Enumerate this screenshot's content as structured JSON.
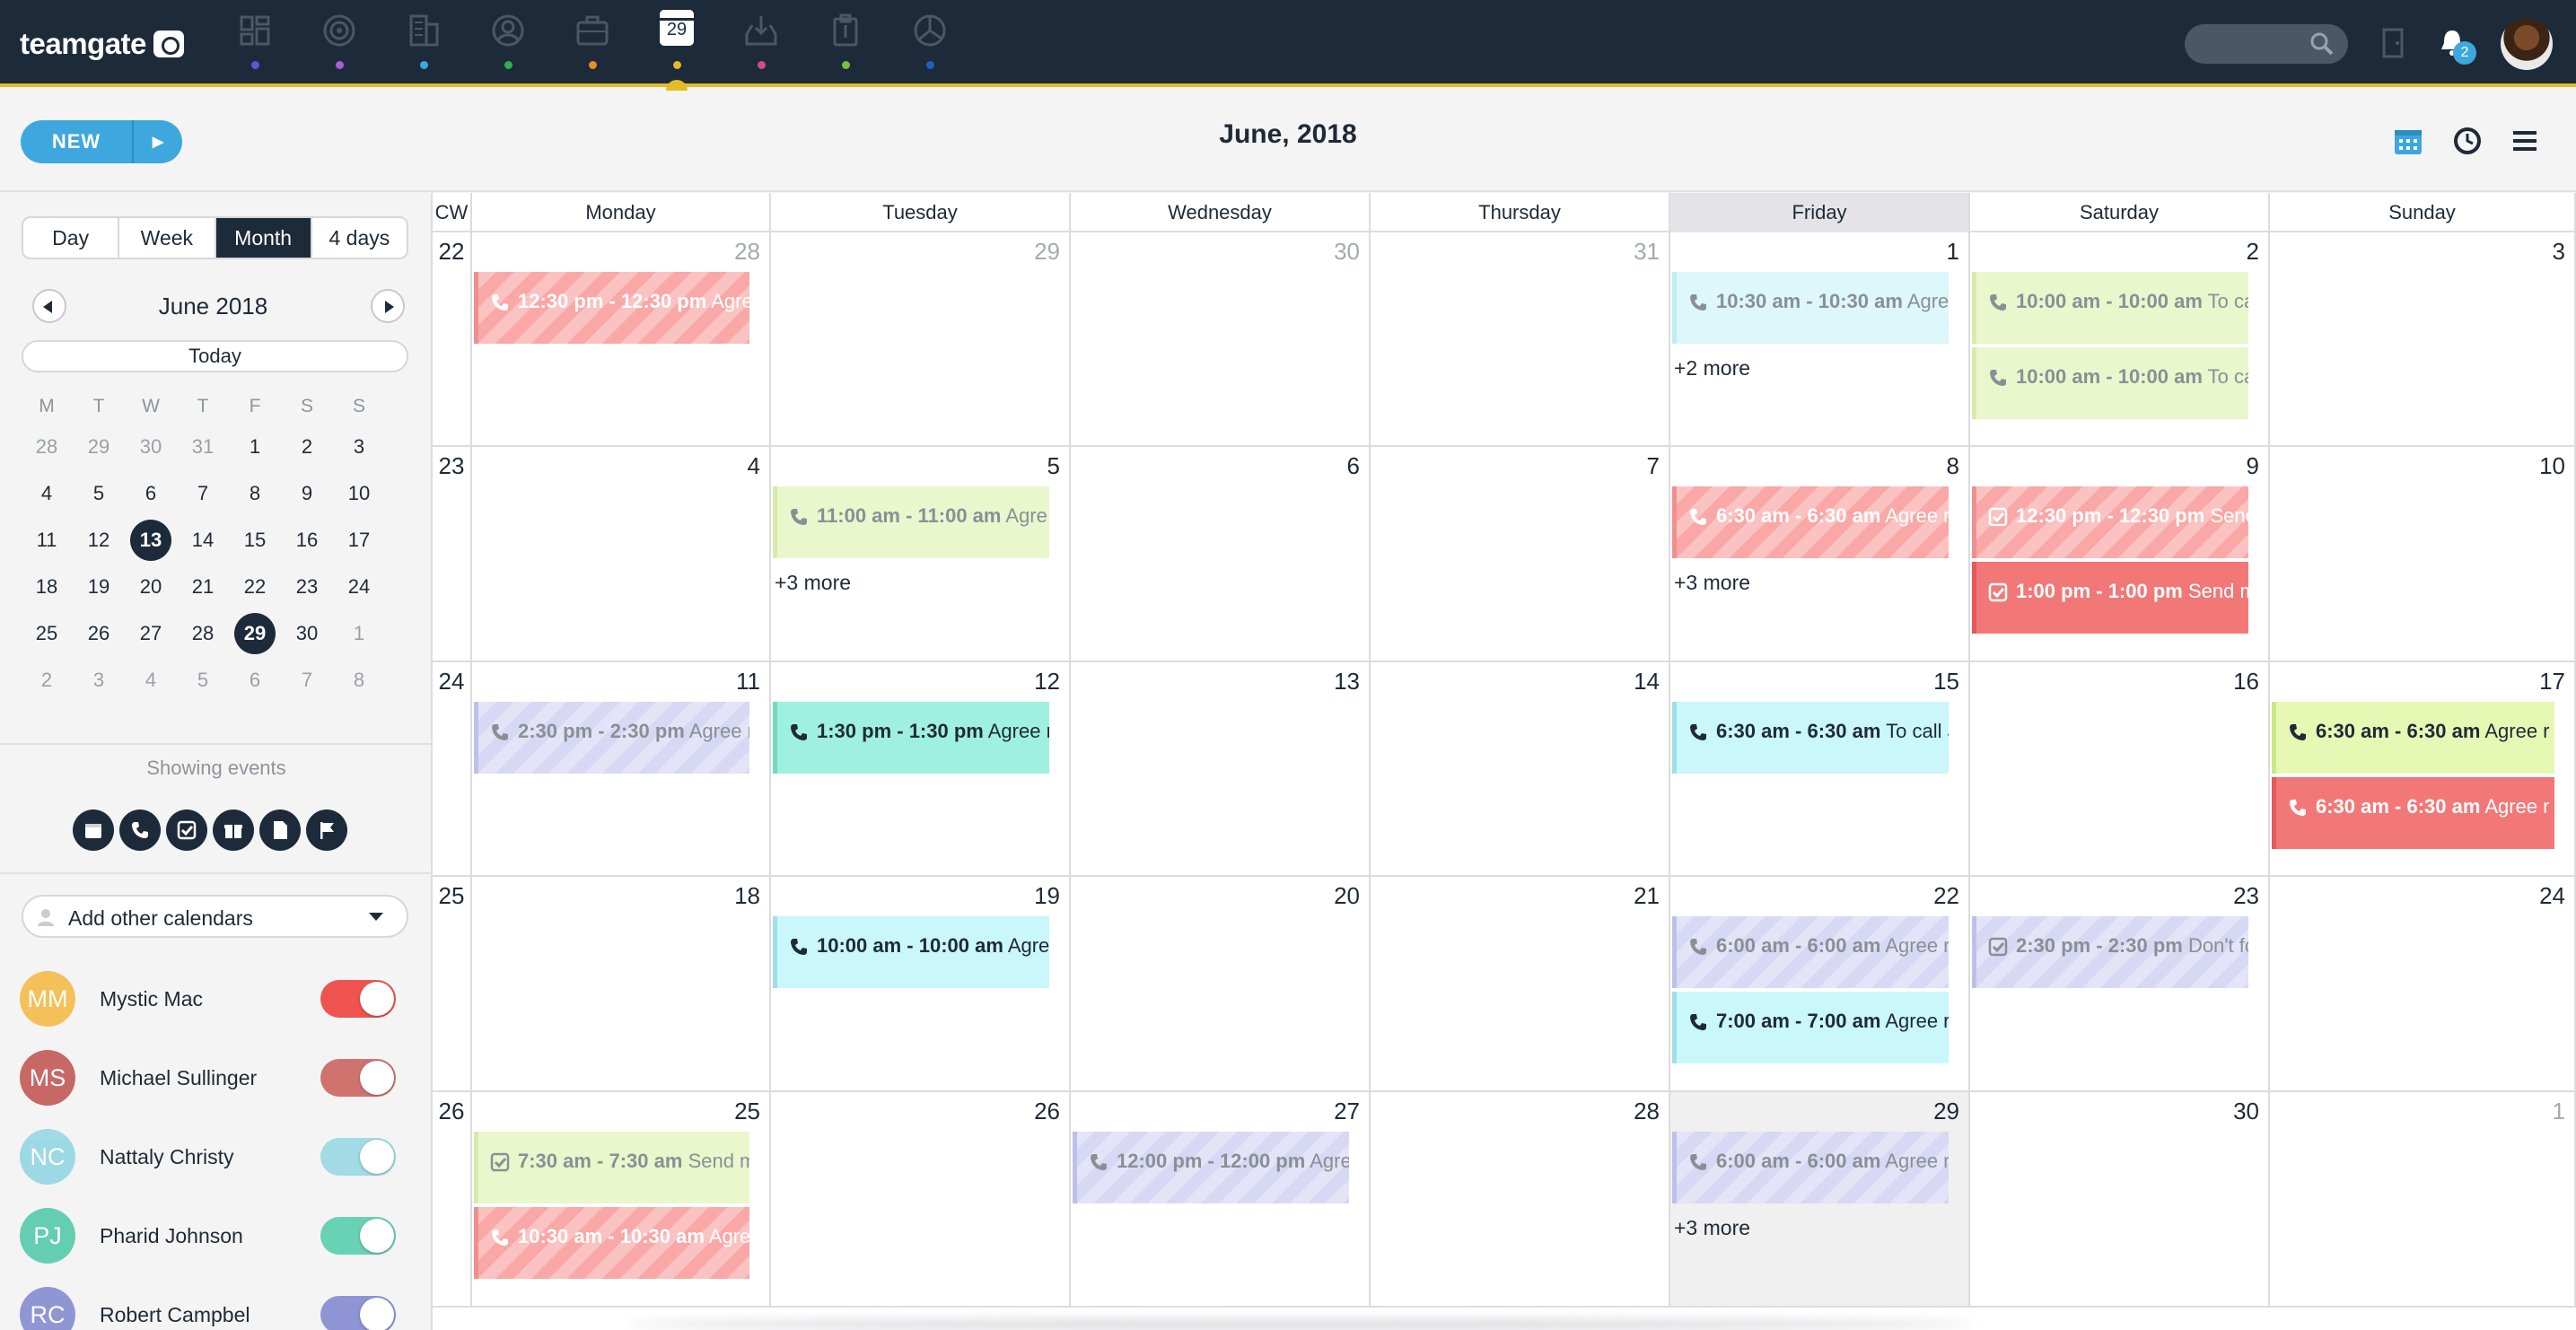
{
  "app": {
    "logo": "teamgate"
  },
  "nav": {
    "today_day": "29",
    "items": [
      {
        "icon": "dashboard-icon",
        "dot": "#5b57d9"
      },
      {
        "icon": "target-icon",
        "dot": "#a85ed6"
      },
      {
        "icon": "building-icon",
        "dot": "#3ea7dd"
      },
      {
        "icon": "contact-icon",
        "dot": "#2fb24a"
      },
      {
        "icon": "briefcase-icon",
        "dot": "#f08a24"
      },
      {
        "icon": "calendar-icon",
        "dot": "#e3bb25"
      },
      {
        "icon": "download-tray-icon",
        "dot": "#d44a8b"
      },
      {
        "icon": "clipboard-icon",
        "dot": "#72c23b"
      },
      {
        "icon": "pie-chart-icon",
        "dot": "#1f5fbf"
      }
    ]
  },
  "topright": {
    "notifications_count": "2"
  },
  "toolbar": {
    "new_label": "NEW",
    "title": "June, 2018"
  },
  "sidebar": {
    "view_tabs": [
      "Day",
      "Week",
      "Month",
      "4 days"
    ],
    "mini_title": "June 2018",
    "today_label": "Today",
    "dows": [
      "M",
      "T",
      "W",
      "T",
      "F",
      "S",
      "S"
    ],
    "weeks": [
      [
        "28",
        "29",
        "30",
        "31",
        "1",
        "2",
        "3"
      ],
      [
        "4",
        "5",
        "6",
        "7",
        "8",
        "9",
        "10"
      ],
      [
        "11",
        "12",
        "13",
        "14",
        "15",
        "16",
        "17"
      ],
      [
        "18",
        "19",
        "20",
        "21",
        "22",
        "23",
        "24"
      ],
      [
        "25",
        "26",
        "27",
        "28",
        "29",
        "30",
        "1"
      ],
      [
        "2",
        "3",
        "4",
        "5",
        "6",
        "7",
        "8"
      ]
    ],
    "showing_label": "Showing events",
    "add_calendars_label": "Add other calendars",
    "people": [
      {
        "initials": "MM",
        "name": "Mystic Mac",
        "avatar": "#f5b840",
        "toggle": "#ef5350",
        "on": true
      },
      {
        "initials": "MS",
        "name": "Michael Sullinger",
        "avatar": "#c0504d",
        "toggle": "#d0736f",
        "on": true
      },
      {
        "initials": "NC",
        "name": "Nattaly Christy",
        "avatar": "#8fd5e2",
        "toggle": "#a2dbe5",
        "on": true
      },
      {
        "initials": "PJ",
        "name": "Pharid Johnson",
        "avatar": "#4cc8a7",
        "toggle": "#67d2b4",
        "on": true
      },
      {
        "initials": "RC",
        "name": "Robert Campbel",
        "avatar": "#7f86cf",
        "toggle": "#8f95d4",
        "on": true
      }
    ]
  },
  "calendar": {
    "cw_label": "CW",
    "days": [
      "Monday",
      "Tuesday",
      "Wednesday",
      "Thursday",
      "Friday",
      "Saturday",
      "Sunday"
    ],
    "weeks": [
      {
        "cw": "22",
        "days": [
          {
            "n": "28",
            "m": true,
            "ev": [
              {
                "t": "12:30 pm - 12:30 pm",
                "s": "Agre",
                "k": "phone",
                "c": "red",
                "h": true,
                "w": true
              }
            ]
          },
          {
            "n": "29",
            "m": true
          },
          {
            "n": "30",
            "m": true
          },
          {
            "n": "31",
            "m": true
          },
          {
            "n": "1",
            "ev": [
              {
                "t": "10:30 am - 10:30 am",
                "s": "Agre",
                "k": "phone",
                "c": "cyan",
                "f": true
              }
            ],
            "more": "+2 more"
          },
          {
            "n": "2",
            "ev": [
              {
                "t": "10:00 am - 10:00 am",
                "s": "To ca",
                "k": "phone",
                "c": "lime",
                "f": true
              },
              {
                "t": "10:00 am - 10:00 am",
                "s": "To ca",
                "k": "phone",
                "c": "lime",
                "f": true
              }
            ]
          },
          {
            "n": "3"
          }
        ]
      },
      {
        "cw": "23",
        "days": [
          {
            "n": "4"
          },
          {
            "n": "5",
            "ev": [
              {
                "t": "11:00 am - 11:00 am",
                "s": "Agre",
                "k": "phone",
                "c": "lime",
                "f": true
              }
            ],
            "more": "+3 more"
          },
          {
            "n": "6"
          },
          {
            "n": "7"
          },
          {
            "n": "8",
            "ev": [
              {
                "t": "6:30 am - 6:30 am",
                "s": "Agree r",
                "k": "phone",
                "c": "red",
                "h": true,
                "f": true
              }
            ],
            "more": "+3 more"
          },
          {
            "n": "9",
            "ev": [
              {
                "t": "12:30 pm - 12:30 pm",
                "s": "Senc",
                "k": "task",
                "c": "red",
                "h": true,
                "w": true
              },
              {
                "t": "1:00 pm - 1:00 pm",
                "s": "Send m",
                "k": "task",
                "c": "redsolid",
                "w": true
              }
            ]
          },
          {
            "n": "10"
          }
        ]
      },
      {
        "cw": "24",
        "days": [
          {
            "n": "11",
            "ev": [
              {
                "t": "2:30 pm - 2:30 pm",
                "s": "Agree r",
                "k": "phone",
                "c": "lav",
                "h": true,
                "f": true
              }
            ]
          },
          {
            "n": "12",
            "ev": [
              {
                "t": "1:30 pm - 1:30 pm",
                "s": "Agree r",
                "k": "phone",
                "c": "teal"
              }
            ]
          },
          {
            "n": "13"
          },
          {
            "n": "14"
          },
          {
            "n": "15",
            "ev": [
              {
                "t": "6:30 am - 6:30 am",
                "s": "To call J",
                "k": "phone",
                "c": "cyan2"
              }
            ]
          },
          {
            "n": "16"
          },
          {
            "n": "17",
            "ev": [
              {
                "t": "6:30 am - 6:30 am",
                "s": "Agree r",
                "k": "phone",
                "c": "lime2"
              },
              {
                "t": "6:30 am - 6:30 am",
                "s": "Agree r",
                "k": "phone",
                "c": "redsolid",
                "w": true
              }
            ]
          }
        ]
      },
      {
        "cw": "25",
        "days": [
          {
            "n": "18"
          },
          {
            "n": "19",
            "ev": [
              {
                "t": "10:00 am - 10:00 am",
                "s": "Agre",
                "k": "phone",
                "c": "cyan2"
              }
            ]
          },
          {
            "n": "20"
          },
          {
            "n": "21"
          },
          {
            "n": "22",
            "ev": [
              {
                "t": "6:00 am - 6:00 am",
                "s": "Agree r",
                "k": "phone",
                "c": "lav",
                "h": true,
                "f": true
              },
              {
                "t": "7:00 am - 7:00 am",
                "s": "Agree r",
                "k": "phone",
                "c": "cyan2"
              }
            ]
          },
          {
            "n": "23",
            "ev": [
              {
                "t": "2:30 pm - 2:30 pm",
                "s": "Don't fo",
                "k": "task",
                "c": "lav",
                "h": true,
                "f": true
              }
            ]
          },
          {
            "n": "24"
          }
        ]
      },
      {
        "cw": "26",
        "days": [
          {
            "n": "25",
            "ev": [
              {
                "t": "7:30 am - 7:30 am",
                "s": "Send m",
                "k": "task",
                "c": "lime",
                "f": true
              },
              {
                "t": "10:30 am - 10:30 am",
                "s": "Agre",
                "k": "phone",
                "c": "red",
                "h": true,
                "w": true
              }
            ]
          },
          {
            "n": "26"
          },
          {
            "n": "27",
            "ev": [
              {
                "t": "12:00 pm - 12:00 pm",
                "s": "Agre",
                "k": "phone",
                "c": "lav",
                "h": true,
                "f": true
              }
            ]
          },
          {
            "n": "28"
          },
          {
            "n": "29",
            "hl": true,
            "ev": [
              {
                "t": "6:00 am - 6:00 am",
                "s": "Agree r",
                "k": "phone",
                "c": "lav",
                "h": true,
                "f": true
              }
            ],
            "more": "+3 more"
          },
          {
            "n": "30"
          },
          {
            "n": "1",
            "m": true
          }
        ]
      }
    ]
  }
}
